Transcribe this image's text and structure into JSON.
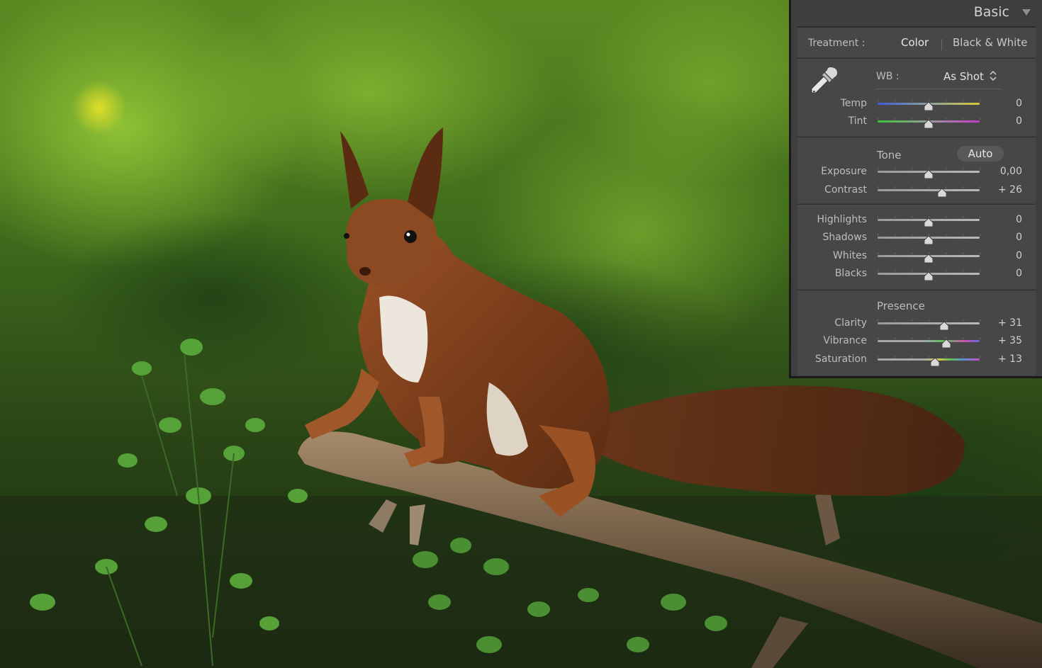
{
  "panel": {
    "title": "Basic",
    "treatment": {
      "label": "Treatment :",
      "color": "Color",
      "bw": "Black & White",
      "selected": "Color"
    },
    "wb": {
      "label": "WB :",
      "value": "As Shot"
    },
    "tone": {
      "label": "Tone",
      "auto_label": "Auto"
    },
    "presence": {
      "label": "Presence"
    },
    "sliders": [
      {
        "label": "Temp",
        "value": "0",
        "position": 0.5,
        "track": "temp"
      },
      {
        "label": "Tint",
        "value": "0",
        "position": 0.5,
        "track": "tint"
      },
      {
        "label": "Exposure",
        "value": "0,00",
        "position": 0.5,
        "track": "gray"
      },
      {
        "label": "Contrast",
        "value": "+ 26",
        "position": 0.63,
        "track": "gray"
      },
      {
        "label": "Highlights",
        "value": "0",
        "position": 0.5,
        "track": "gray"
      },
      {
        "label": "Shadows",
        "value": "0",
        "position": 0.5,
        "track": "gray"
      },
      {
        "label": "Whites",
        "value": "0",
        "position": 0.5,
        "track": "gray"
      },
      {
        "label": "Blacks",
        "value": "0",
        "position": 0.5,
        "track": "gray"
      },
      {
        "label": "Clarity",
        "value": "+ 31",
        "position": 0.655,
        "track": "gray"
      },
      {
        "label": "Vibrance",
        "value": "+ 35",
        "position": 0.675,
        "track": "vibrance"
      },
      {
        "label": "Saturation",
        "value": "+ 13",
        "position": 0.565,
        "track": "saturation"
      }
    ]
  },
  "colors": {
    "panel_bg": "#3e3e3e",
    "section_bg": "#474747",
    "temp_start": "#3d5bd6",
    "temp_end": "#d6c93a",
    "tint_start": "#3bc43b",
    "tint_end": "#c33bc9"
  },
  "icons": [
    "eyedropper-icon",
    "up-down-arrows-icon",
    "collapse-triangle-icon"
  ]
}
